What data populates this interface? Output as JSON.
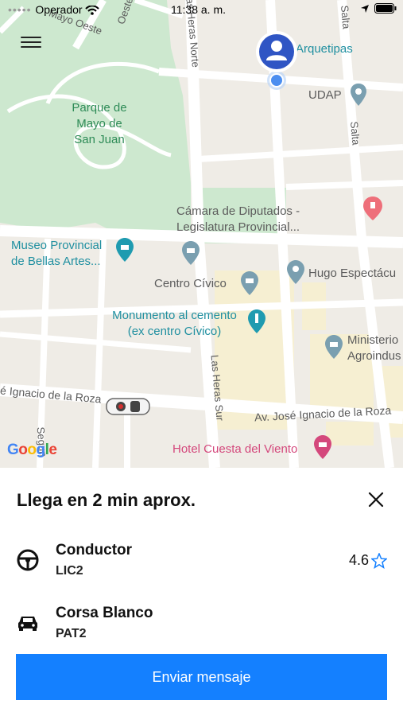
{
  "status_bar": {
    "carrier": "Operador",
    "time": "11:38 a. m."
  },
  "map": {
    "labels": {
      "arquetipas": "Arquetipas",
      "udap": "UDAP",
      "salta_top": "Salta",
      "salta_mid": "Salta",
      "mayo_oeste": "Mayo Oeste",
      "ote": "Oeste",
      "heras_norte": "Las Heras Norte",
      "park": "Parque de Mayo de San Juan",
      "camara": "Cámara de Diputados - Legislatura Provincial...",
      "museo": "Museo Provincial de Bellas Artes...",
      "centro_civico": "Centro Cívico",
      "hugo": "Hugo Espectácu",
      "monumento": "Monumento al cemento (ex centro Cívico)",
      "ministerio": "Ministerio Agroindus",
      "roza_left": "é Ignacio de la Roza",
      "roza_right": "Av. José Ignacio de la Roza",
      "heras_sur": "Las Heras Sur",
      "segun": "Segun",
      "hotel": "Hotel Cuesta del Viento"
    },
    "attribution": "Google"
  },
  "sheet": {
    "title": "Llega en 2 min aprox.",
    "driver": {
      "label": "Conductor",
      "id": "LIC2",
      "rating": "4.6"
    },
    "vehicle": {
      "label": "Corsa Blanco",
      "plate": "PAT2"
    },
    "send_button": "Enviar mensaje"
  },
  "colors": {
    "accent": "#1480ff",
    "pin": "#2f55c4"
  }
}
